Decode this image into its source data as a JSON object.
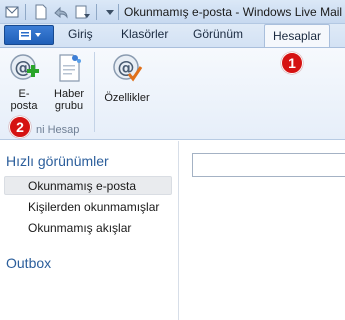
{
  "window": {
    "title": "Okunmamış e-posta - Windows Live Mail"
  },
  "quick_access": {
    "icons": [
      "mail-icon",
      "reply-icon",
      "customize-dropdown-icon"
    ]
  },
  "ribbon_tabs": [
    "Giriş",
    "Klasörler",
    "Görünüm",
    "Hesaplar"
  ],
  "active_tab": "Hesaplar",
  "ribbon": {
    "buttons": [
      {
        "label_line1": "E-",
        "label_line2": "posta",
        "icon": "email-add-icon"
      },
      {
        "label_line1": "Haber",
        "label_line2": "grubu",
        "icon": "newsgroup-icon"
      },
      {
        "label_line1": "Özellikler",
        "label_line2": "",
        "icon": "properties-icon"
      }
    ],
    "group_label": "ni Hesap"
  },
  "annotations": {
    "badge1": "1",
    "badge2": "2"
  },
  "nav": {
    "heading": "Hızlı görünümler",
    "items": [
      "Okunmamış e-posta",
      "Kişilerden okunmamışlar",
      "Okunmamış akışlar"
    ],
    "selected_index": 0,
    "outbox": "Outbox"
  },
  "colors": {
    "accent": "#2b5e9b",
    "badge": "#d51212",
    "app_menu": "#2a6cc8"
  }
}
